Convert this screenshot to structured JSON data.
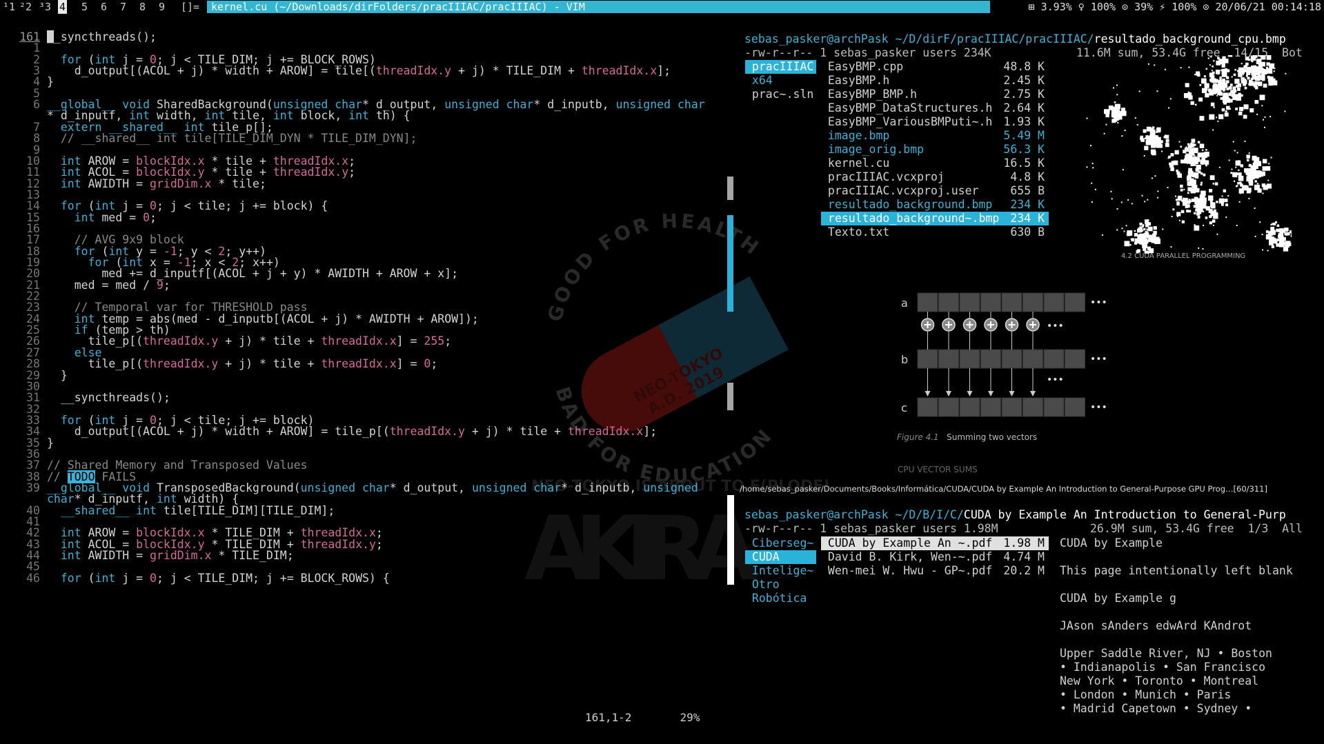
{
  "topbar": {
    "workspaces": [
      "¹1",
      "²2",
      "³3",
      "4",
      "5",
      "6",
      "7",
      "8",
      "9",
      "[]="
    ],
    "active_index": 3,
    "title": "kernel.cu (~/Downloads/dirFolders/pracIIIAC/pracIIIAC) - VIM",
    "status": "⊞ 3.93% ♀ 100% ⊙ 39% ⚡ 100% ⊙ 20/06/21 00:14:18"
  },
  "vim": {
    "lines": [
      {
        "n": "161",
        "cur": true,
        "code": "__syncthreads();"
      },
      {
        "n": "1",
        "code": ""
      },
      {
        "n": "2",
        "code": "  for (int j = 0; j < TILE_DIM; j += BLOCK_ROWS)"
      },
      {
        "n": "3",
        "code": "    d_output[(ACOL + j) * width + AROW] = tile[(threadIdx.y + j) * TILE_DIM + threadIdx.x];"
      },
      {
        "n": "4",
        "code": "}"
      },
      {
        "n": "5",
        "code": ""
      },
      {
        "n": "6",
        "code": "__global__ void SharedBackground(unsigned char* d_output, unsigned char* d_inputb, unsigned char"
      },
      {
        "n": "",
        "code": "* d_inputf, int width, int tile, int block, int th) {"
      },
      {
        "n": "7",
        "code": "  extern __shared__ int tile_p[];"
      },
      {
        "n": "8",
        "code": "  // __shared__ int tile[TILE_DIM_DYN * TILE_DIM_DYN];"
      },
      {
        "n": "9",
        "code": ""
      },
      {
        "n": "10",
        "code": "  int AROW = blockIdx.x * tile + threadIdx.x;"
      },
      {
        "n": "11",
        "code": "  int ACOL = blockIdx.y * tile + threadIdx.y;"
      },
      {
        "n": "12",
        "code": "  int AWIDTH = gridDim.x * tile;"
      },
      {
        "n": "13",
        "code": ""
      },
      {
        "n": "14",
        "code": "  for (int j = 0; j < tile; j += block) {"
      },
      {
        "n": "15",
        "code": "    int med = 0;"
      },
      {
        "n": "16",
        "code": ""
      },
      {
        "n": "17",
        "code": "    // AVG 9x9 block"
      },
      {
        "n": "18",
        "code": "    for (int y = -1; y < 2; y++)"
      },
      {
        "n": "19",
        "code": "      for (int x = -1; x < 2; x++)"
      },
      {
        "n": "20",
        "code": "        med += d_inputf[(ACOL + j + y) * AWIDTH + AROW + x];"
      },
      {
        "n": "21",
        "code": "    med = med / 9;"
      },
      {
        "n": "22",
        "code": ""
      },
      {
        "n": "23",
        "code": "    // Temporal var for THRESHOLD pass"
      },
      {
        "n": "24",
        "code": "    int temp = abs(med - d_inputb[(ACOL + j) * AWIDTH + AROW]);"
      },
      {
        "n": "25",
        "code": "    if (temp > th)"
      },
      {
        "n": "26",
        "code": "      tile_p[(threadIdx.y + j) * tile + threadIdx.x] = 255;"
      },
      {
        "n": "27",
        "code": "    else"
      },
      {
        "n": "28",
        "code": "      tile_p[(threadIdx.y + j) * tile + threadIdx.x] = 0;"
      },
      {
        "n": "29",
        "code": "  }"
      },
      {
        "n": "30",
        "code": ""
      },
      {
        "n": "31",
        "code": "  __syncthreads();"
      },
      {
        "n": "32",
        "code": ""
      },
      {
        "n": "33",
        "code": "  for (int j = 0; j < tile; j += block)"
      },
      {
        "n": "34",
        "code": "    d_output[(ACOL + j) * width + AROW] = tile_p[(threadIdx.y + j) * tile + threadIdx.x];"
      },
      {
        "n": "35",
        "code": "}"
      },
      {
        "n": "36",
        "code": ""
      },
      {
        "n": "37",
        "code": "// Shared Memory and Transposed Values"
      },
      {
        "n": "38",
        "code": "// TODO FAILS"
      },
      {
        "n": "39",
        "code": "__global__ void TransposedBackground(unsigned char* d_output, unsigned char* d_inputb, unsigned"
      },
      {
        "n": "",
        "code": "char* d_inputf, int width) {"
      },
      {
        "n": "40",
        "code": "  __shared__ int tile[TILE_DIM][TILE_DIM];"
      },
      {
        "n": "41",
        "code": ""
      },
      {
        "n": "42",
        "code": "  int AROW = blockIdx.x * TILE_DIM + threadIdx.x;"
      },
      {
        "n": "43",
        "code": "  int ACOL = blockIdx.y * TILE_DIM + threadIdx.y;"
      },
      {
        "n": "44",
        "code": "  int AWIDTH = gridDim.x * TILE_DIM;"
      },
      {
        "n": "45",
        "code": ""
      },
      {
        "n": "46",
        "code": "  for (int j = 0; j < TILE_DIM; j += BLOCK_ROWS) {"
      }
    ],
    "position": "161,1-2",
    "percent": "29%"
  },
  "wallpaper": {
    "ring_top": "GOOD FOR HEALTH",
    "ring_bottom": "BAD FOR EDUCATION",
    "pill_text1": "NEO-TOKYO",
    "pill_text2": "A.D. 2019",
    "tagline": "NEO-TOKYO IS ABOUT TO E(PLODE!",
    "logo": "AKIRA"
  },
  "ranger1": {
    "user": "sebas_pasker@archPask",
    "path": " ~/D/dirF/pracIIIAC/pracIIIAC/",
    "file": "resultado_background_cpu.bmp",
    "perm": "-rw-r--r-- 1 sebas_pasker users 234K",
    "summary": "11.6M sum, 53.4G free  14/15  Bot",
    "parents": [
      {
        "name": "pracIIIAC",
        "state": "sel"
      },
      {
        "name": "x64",
        "state": "blue"
      },
      {
        "name": "prac~.sln",
        "state": ""
      }
    ],
    "files": [
      {
        "name": "EasyBMP.cpp",
        "size": "48.8 K",
        "state": ""
      },
      {
        "name": "EasyBMP.h",
        "size": "2.45 K",
        "state": ""
      },
      {
        "name": "EasyBMP_BMP.h",
        "size": "2.75 K",
        "state": ""
      },
      {
        "name": "EasyBMP_DataStructures.h",
        "size": "2.64 K",
        "state": ""
      },
      {
        "name": "EasyBMP_VariousBMPuti~.h",
        "size": "1.93 K",
        "state": ""
      },
      {
        "name": "image.bmp",
        "size": "5.49 M",
        "state": "blue"
      },
      {
        "name": "image_orig.bmp",
        "size": "56.3 K",
        "state": "blue"
      },
      {
        "name": "kernel.cu",
        "size": "16.5 K",
        "state": ""
      },
      {
        "name": "pracIIIAC.vcxproj",
        "size": "4.8 K",
        "state": ""
      },
      {
        "name": "pracIIIAC.vcxproj.user",
        "size": "655 B",
        "state": ""
      },
      {
        "name": "resultado_background.bmp",
        "size": "234 K",
        "state": "blue"
      },
      {
        "name": "resultado_background~.bmp",
        "size": "234 K",
        "state": "sel"
      },
      {
        "name": "Texto.txt",
        "size": "630 B",
        "state": ""
      }
    ]
  },
  "figure": {
    "small_header": "4.2 CUDA PARALLEL PROGRAMMING",
    "row_a": "a",
    "row_b": "b",
    "row_c": "c",
    "ellipsis": "•••",
    "fig_num": "Figure 4.1",
    "caption": "Summing two vectors",
    "section": "CPU VECTOR SUMS",
    "pdf_path": "/home/sebas_pasker/Documents/Books/Informática/CUDA/CUDA by Example An Introduction to General-Purpose GPU Prog…[60/311]"
  },
  "ranger2": {
    "user": "sebas_pasker@archPask",
    "path": " ~/D/B/I/C/",
    "file": "CUDA by Example An Introduction to General-Purp",
    "perm": "-rw-r--r-- 1 sebas_pasker users 1.98M",
    "summary": "26.9M sum, 53.4G free  1/3  All",
    "parents": [
      {
        "name": "Ciberseg~",
        "state": "blue"
      },
      {
        "name": "CUDA",
        "state": "sel"
      },
      {
        "name": "Intelige~",
        "state": "blue"
      },
      {
        "name": "Otro",
        "state": "blue"
      },
      {
        "name": "Robótica",
        "state": "blue"
      }
    ],
    "files": [
      {
        "name": "CUDA by Example An ~.pdf",
        "size": "1.98 M",
        "state": "sel2"
      },
      {
        "name": "David B. Kirk, Wen-~.pdf",
        "size": "4.74 M",
        "state": ""
      },
      {
        "name": "Wen-mei W. Hwu - GP~.pdf",
        "size": "20.2 M",
        "state": ""
      }
    ],
    "preview": [
      "CUDA by Example",
      "",
      "This page intentionally left blank",
      "",
      "CUDA by Example g",
      "",
      "JAson sAnders edwArd KAndrot",
      "",
      "Upper Saddle River, NJ • Boston",
      "• Indianapolis • San Francisco",
      "New York • Toronto • Montreal",
      "• London • Munich • Paris",
      "• Madrid Capetown • Sydney •"
    ]
  }
}
